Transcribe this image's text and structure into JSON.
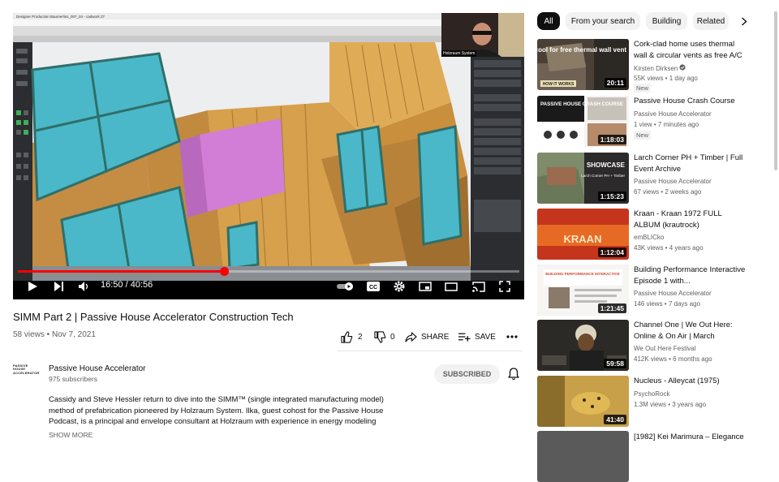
{
  "player": {
    "time_current": "16:50",
    "time_total": "40:56",
    "progress": 0.411,
    "cam_label": "Holzraum System",
    "software_window_title": "Designer Production Baumerlins_007_04 - cadwork 27"
  },
  "video": {
    "title": "SIMM Part 2 | Passive House Accelerator Construction Tech",
    "meta": "58 views • Nov 7, 2021",
    "likes": "2",
    "dislikes": "0",
    "share_label": "SHARE",
    "save_label": "SAVE"
  },
  "channel": {
    "avatar_text": "PASSIVE HOUSE ACCELERATOR",
    "name": "Passive House Accelerator",
    "subscribers": "975 subscribers",
    "subscribed_label": "SUBSCRIBED"
  },
  "description": {
    "text": "Cassidy and Steve Hessler return to dive into the SIMM™ (single integrated manufacturing model) method of prefabrication pioneered by Holzraum System. Ilka, guest cohost for the Passive House Podcast, is a principal and envelope consultant at Holzraum with experience in energy modeling",
    "show_more": "SHOW MORE"
  },
  "chips": [
    "All",
    "From your search",
    "Building",
    "Related"
  ],
  "recommendations": [
    {
      "title": "Cork-clad home uses thermal wall & circular vents as free A/C",
      "channel": "Kirsten Dirksen",
      "verified": true,
      "stats": "55K views • 1 day ago",
      "badge": "New",
      "duration": "20:11",
      "thumb_text": "Warm/cool for free thermal wall vent",
      "thumb_tag": "HOW IT WORKS"
    },
    {
      "title": "Passive House Crash Course",
      "channel": "Passive House Accelerator",
      "verified": false,
      "stats": "1 view • 7 minutes ago",
      "badge": "New",
      "duration": "1:18:03",
      "thumb_text": "PASSIVE HOUSE CRASH COURSE",
      "thumb_tag": ""
    },
    {
      "title": "Larch Corner PH + Timber | Full Event Archive",
      "channel": "Passive House Accelerator",
      "verified": false,
      "stats": "67 views • 2 weeks ago",
      "badge": "",
      "duration": "1:15:23",
      "thumb_text": "SHOWCASE",
      "thumb_tag": "Larch Corner PH + Timber"
    },
    {
      "title": "Kraan - Kraan 1972 FULL ALBUM (krautrock)",
      "channel": "emBLICko",
      "verified": false,
      "stats": "43K views • 4 years ago",
      "badge": "",
      "duration": "1:12:04",
      "thumb_text": "KRAAN",
      "thumb_tag": ""
    },
    {
      "title": "Building Performance Interactive Episode 1 with...",
      "channel": "Passive House Accelerator",
      "verified": false,
      "stats": "146 views • 7 days ago",
      "badge": "",
      "duration": "1:21:45",
      "thumb_text": "BUILDING PERFORMANCE INTERACTIVE",
      "thumb_tag": ""
    },
    {
      "title": "Channel One | We Out Here: Online & On Air | March",
      "channel": "We Out Here Festival",
      "verified": false,
      "stats": "412K views • 6 months ago",
      "badge": "",
      "duration": "59:58",
      "thumb_text": "",
      "thumb_tag": ""
    },
    {
      "title": "Nucleus - Alleycat (1975)",
      "channel": "PsychoRock",
      "verified": false,
      "stats": "1.3M views • 3 years ago",
      "badge": "",
      "duration": "41:40",
      "thumb_text": "",
      "thumb_tag": ""
    },
    {
      "title": "[1982] Kei Marimura – Elegance",
      "channel": "",
      "verified": false,
      "stats": "",
      "badge": "",
      "duration": "",
      "thumb_text": "",
      "thumb_tag": ""
    }
  ],
  "colors": {
    "progress_red": "#ff0000",
    "chip_active_bg": "#0f0f0f",
    "chip_bg": "#f2f2f2",
    "secondary_text": "#606060",
    "window_glass": "#4ab8c8",
    "wall_pink": "#d27ed6",
    "timber": "#d9a24a"
  }
}
